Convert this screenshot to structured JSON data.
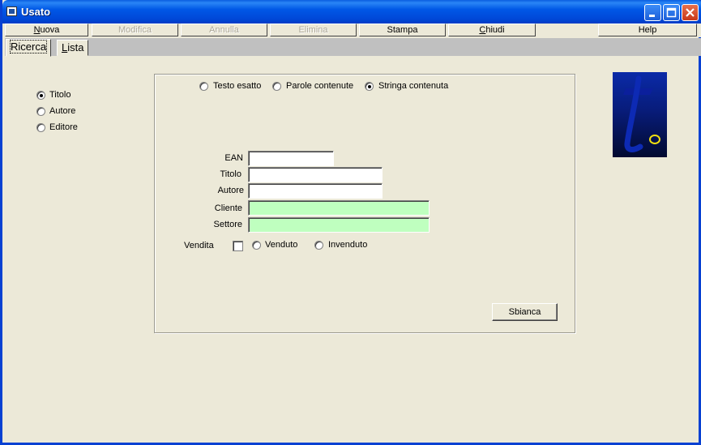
{
  "window": {
    "title": "Usato"
  },
  "menu": {
    "items": [
      {
        "label": "Nuova",
        "underline": "N",
        "rest": "uova",
        "enabled": true
      },
      {
        "label": "Modifica",
        "enabled": false
      },
      {
        "label": "Annulla",
        "enabled": false
      },
      {
        "label": "Elimina",
        "enabled": false
      },
      {
        "label": "Stampa",
        "enabled": true
      },
      {
        "label": "Chiudi",
        "underline": "C",
        "rest": "hiudi",
        "enabled": true
      },
      {
        "label": "Help",
        "enabled": true
      }
    ]
  },
  "tabs": [
    {
      "label": "Ricerca",
      "active": true
    },
    {
      "label": "Lista",
      "underline": "L",
      "rest": "ista",
      "active": false
    }
  ],
  "search_field": {
    "options": [
      {
        "label": "Titolo",
        "checked": true
      },
      {
        "label": "Autore",
        "checked": false
      },
      {
        "label": "Editore",
        "checked": false
      }
    ]
  },
  "match_mode": {
    "options": [
      {
        "label": "Testo esatto",
        "checked": false
      },
      {
        "label": "Parole contenute",
        "checked": false
      },
      {
        "label": "Stringa contenuta",
        "checked": true
      }
    ]
  },
  "form": {
    "ean": {
      "label": "EAN",
      "value": ""
    },
    "titolo": {
      "label": "Titolo",
      "value": ""
    },
    "autore": {
      "label": "Autore",
      "value": ""
    },
    "cliente": {
      "label": "Cliente",
      "value": ""
    },
    "settore": {
      "label": "Settore",
      "value": ""
    },
    "vendita": {
      "label": "Vendita",
      "checked": false
    },
    "venduto": {
      "label": "Venduto",
      "checked": false
    },
    "invenduto": {
      "label": "Invenduto",
      "checked": false
    },
    "clear_button": "Sbianca"
  },
  "colors": {
    "accent_field": "#bfffbf",
    "titlebar": "#0058e6"
  }
}
